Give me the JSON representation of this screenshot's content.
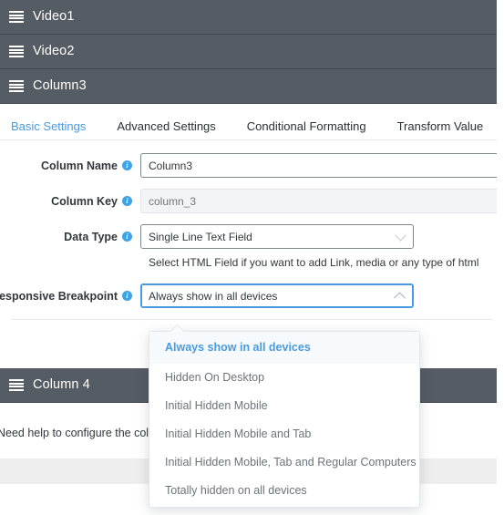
{
  "columns": [
    {
      "title": "Video1",
      "icon": "drag-handle-icon"
    },
    {
      "title": "Video2",
      "icon": "drag-handle-icon"
    },
    {
      "title": "Column3",
      "icon": "drag-handle-icon"
    }
  ],
  "bottom_column": {
    "title": "Column 4",
    "icon": "drag-handle-icon"
  },
  "tabs": [
    {
      "label": "Basic Settings",
      "active": true
    },
    {
      "label": "Advanced Settings",
      "active": false
    },
    {
      "label": "Conditional Formatting",
      "active": false
    },
    {
      "label": "Transform Value",
      "active": false
    }
  ],
  "form": {
    "column_name": {
      "label": "Column Name",
      "value": "Column3",
      "info_icon": "info-icon"
    },
    "column_key": {
      "label": "Column Key",
      "value": "column_3",
      "placeholder": "column_3",
      "info_icon": "info-icon"
    },
    "data_type": {
      "label": "Data Type",
      "value": "Single Line Text Field",
      "info_icon": "info-icon",
      "chevron": "chevron-down-icon",
      "hint": "Select HTML Field if you want to add Link, media or any type of html"
    },
    "responsive_breakpoint": {
      "label": "Responsive Breakpoint",
      "value": "Always show in all devices",
      "info_icon": "info-icon",
      "chevron": "chevron-up-icon"
    }
  },
  "dropdown": {
    "options": [
      {
        "label": "Always show in all devices",
        "selected": true
      },
      {
        "label": "Hidden On Desktop",
        "selected": false
      },
      {
        "label": "Initial Hidden Mobile",
        "selected": false
      },
      {
        "label": "Initial Hidden Mobile and Tab",
        "selected": false
      },
      {
        "label": "Initial Hidden Mobile, Tab and Regular Computers",
        "selected": false
      },
      {
        "label": "Totally hidden on all devices",
        "selected": false
      }
    ]
  },
  "footer": {
    "note": "Need help to configure the columns an"
  },
  "colors": {
    "bar_bg": "#555c63",
    "accent": "#4a9ae0",
    "text": "#32373c",
    "muted": "#6d737a"
  }
}
